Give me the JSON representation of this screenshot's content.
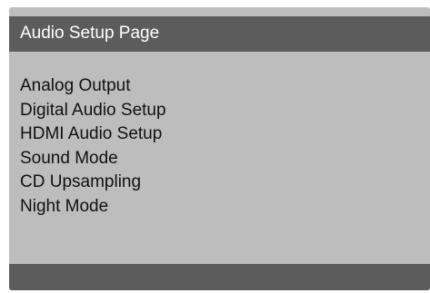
{
  "header": {
    "title": "Audio Setup Page"
  },
  "menu": {
    "items": [
      {
        "label": "Analog Output"
      },
      {
        "label": "Digital Audio Setup"
      },
      {
        "label": "HDMI Audio Setup"
      },
      {
        "label": "Sound Mode"
      },
      {
        "label": "CD Upsampling"
      },
      {
        "label": "Night Mode"
      }
    ]
  },
  "colors": {
    "panel_background": "#bdbdbd",
    "bar_background": "#5c5c5c",
    "title_text": "#ffffff",
    "menu_text": "#111111"
  }
}
